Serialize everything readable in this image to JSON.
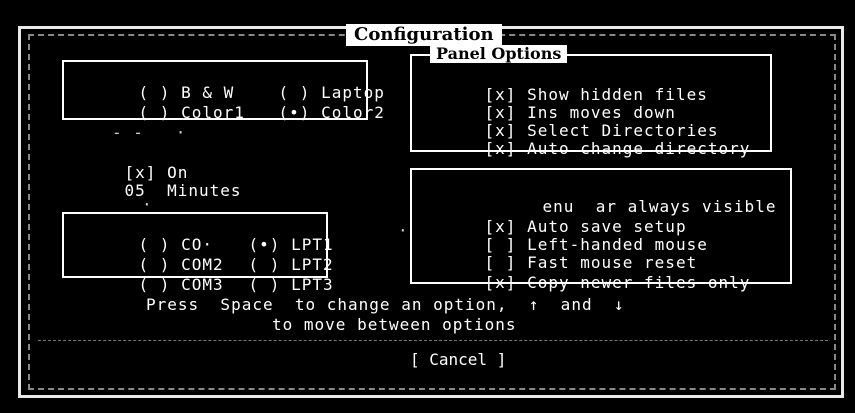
{
  "dialog": {
    "title": "Configuration",
    "panel_options_label": "Panel Options",
    "hint_line1": "Press  Space  to change an option,  ↑  and  ↓",
    "hint_line2": "to move between options",
    "cancel_label": "[ Cancel ]"
  },
  "screen_colors": {
    "radios": [
      {
        "state": "( )",
        "label": "B & W"
      },
      {
        "state": "( )",
        "label": "Laptop"
      },
      {
        "state": "( )",
        "label": "Color1"
      },
      {
        "state": "(•)",
        "label": "Color2"
      }
    ]
  },
  "screen_blank": {
    "checkbox": "[x]",
    "checkbox_label": "On",
    "minutes_value": "05",
    "minutes_label": "Minutes",
    "dots_top": "- -   ·",
    "dot_mid": "·"
  },
  "printer": {
    "ports": [
      {
        "state": "( )",
        "label": "CO·"
      },
      {
        "state": "(•)",
        "label": "LPT1"
      },
      {
        "state": "( )",
        "label": "COM2"
      },
      {
        "state": "( )",
        "label": "LPT2"
      },
      {
        "state": "( )",
        "label": "COM3"
      },
      {
        "state": "( )",
        "label": "LPT3"
      }
    ]
  },
  "panel_options": {
    "items": [
      {
        "state": "[x]",
        "label": "Show hidden files"
      },
      {
        "state": "[x]",
        "label": "Ins moves down"
      },
      {
        "state": "[x]",
        "label": "Select Directories"
      },
      {
        "state": "[x]",
        "label": "Auto change directory"
      }
    ]
  },
  "other_options": {
    "items": [
      {
        "state": "",
        "label": "enu  ar always visible"
      },
      {
        "state": "[x]",
        "label": "Auto save setup"
      },
      {
        "state": "[ ]",
        "label": "Left-handed mouse"
      },
      {
        "state": "[ ]",
        "label": "Fast mouse reset"
      },
      {
        "state": "[x]",
        "label": "Copy newer files only"
      }
    ]
  }
}
